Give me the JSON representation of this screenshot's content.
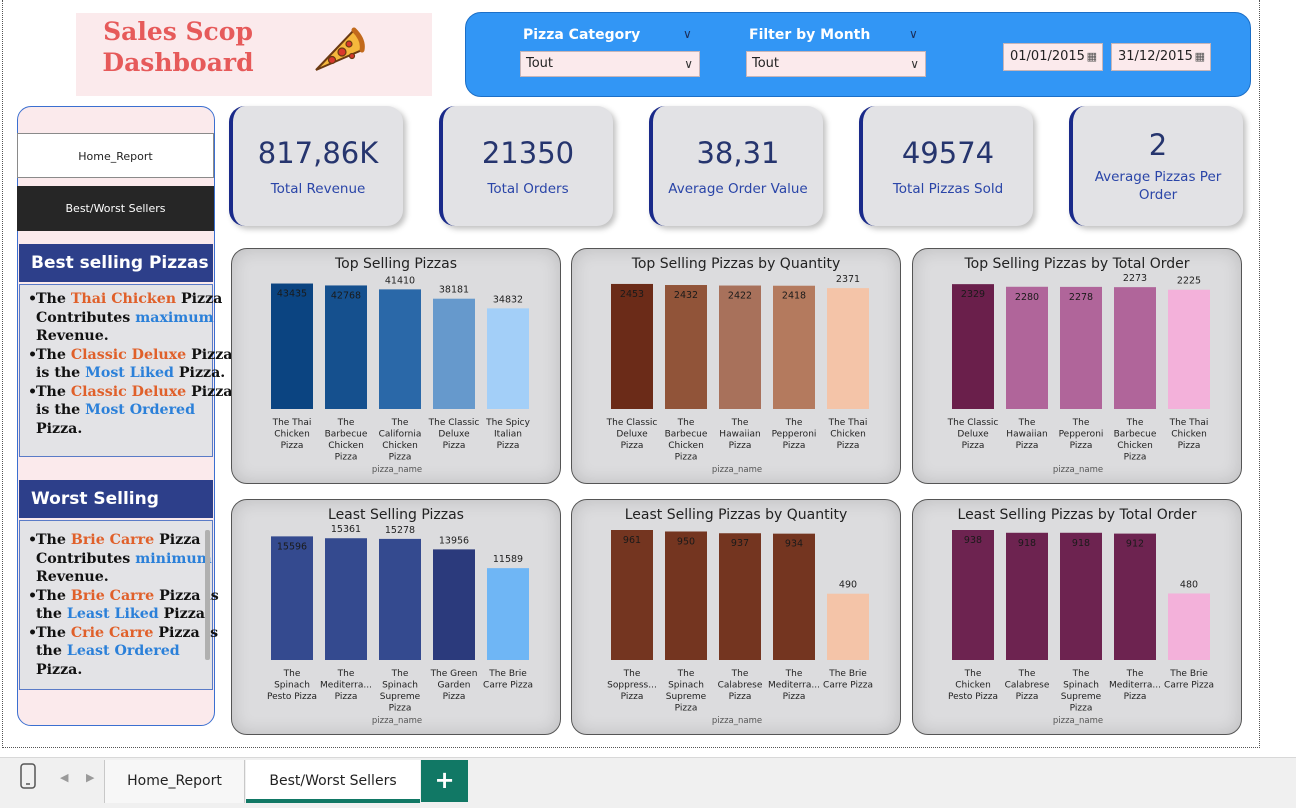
{
  "header": {
    "title_line1": "Sales Scop",
    "title_line2": "Dashboard",
    "logo_icon": "pizza-slice-icon"
  },
  "filters": {
    "category_label": "Pizza Category",
    "category_value": "Tout",
    "month_label": "Filter by Month",
    "month_value": "Tout",
    "date_start": "01/01/2015",
    "date_end": "31/12/2015"
  },
  "nav": {
    "home_label": "Home_Report",
    "sellers_label": "Best/Worst Sellers"
  },
  "best_section": {
    "title": "Best selling Pizzas",
    "lines": [
      {
        "bullet": true,
        "parts": [
          {
            "t": "The ",
            "c": ""
          },
          {
            "t": "Thai Chicken",
            "c": "o"
          },
          {
            "t": " Pizza",
            "c": ""
          }
        ]
      },
      {
        "bullet": false,
        "parts": [
          {
            "t": "Contributes ",
            "c": ""
          },
          {
            "t": "maximum",
            "c": "b"
          }
        ]
      },
      {
        "bullet": false,
        "parts": [
          {
            "t": "Revenue.",
            "c": ""
          }
        ]
      },
      {
        "bullet": true,
        "parts": [
          {
            "t": "The ",
            "c": ""
          },
          {
            "t": "Classic Deluxe",
            "c": "o"
          },
          {
            "t": " Pizza",
            "c": ""
          }
        ]
      },
      {
        "bullet": false,
        "parts": [
          {
            "t": "is the ",
            "c": ""
          },
          {
            "t": "Most Liked",
            "c": "b"
          },
          {
            "t": " Pizza.",
            "c": ""
          }
        ]
      },
      {
        "bullet": true,
        "parts": [
          {
            "t": "The ",
            "c": ""
          },
          {
            "t": "Classic Deluxe",
            "c": "o"
          },
          {
            "t": " Pizza",
            "c": ""
          }
        ]
      },
      {
        "bullet": false,
        "parts": [
          {
            "t": "is the ",
            "c": ""
          },
          {
            "t": "Most Ordered",
            "c": "b"
          }
        ]
      },
      {
        "bullet": false,
        "parts": [
          {
            "t": "Pizza.",
            "c": ""
          }
        ]
      }
    ]
  },
  "worst_section": {
    "title": "Worst Selling Pizzas",
    "lines": [
      {
        "bullet": true,
        "parts": [
          {
            "t": "The ",
            "c": ""
          },
          {
            "t": "Brie Carre",
            "c": "o"
          },
          {
            "t": " Pizza",
            "c": ""
          }
        ]
      },
      {
        "bullet": false,
        "parts": [
          {
            "t": "Contributes ",
            "c": ""
          },
          {
            "t": "minimum",
            "c": "b"
          }
        ]
      },
      {
        "bullet": false,
        "parts": [
          {
            "t": "Revenue.",
            "c": ""
          }
        ]
      },
      {
        "bullet": true,
        "parts": [
          {
            "t": "The ",
            "c": ""
          },
          {
            "t": "Brie Carre",
            "c": "o"
          },
          {
            "t": " Pizza is",
            "c": ""
          }
        ]
      },
      {
        "bullet": false,
        "parts": [
          {
            "t": "the ",
            "c": ""
          },
          {
            "t": "Least Liked",
            "c": "b"
          },
          {
            "t": " Pizza.",
            "c": ""
          }
        ]
      },
      {
        "bullet": true,
        "parts": [
          {
            "t": "The ",
            "c": ""
          },
          {
            "t": "Crie Carre",
            "c": "o"
          },
          {
            "t": " Pizza is",
            "c": ""
          }
        ]
      },
      {
        "bullet": false,
        "parts": [
          {
            "t": "the ",
            "c": ""
          },
          {
            "t": "Least Ordered",
            "c": "b"
          }
        ]
      },
      {
        "bullet": false,
        "parts": [
          {
            "t": "Pizza.",
            "c": ""
          }
        ]
      }
    ]
  },
  "kpis": [
    {
      "value": "817,86K",
      "label": "Total Revenue"
    },
    {
      "value": "21350",
      "label": "Total Orders"
    },
    {
      "value": "38,31",
      "label": "Average Order Value"
    },
    {
      "value": "49574",
      "label": "Total Pizzas Sold"
    },
    {
      "value": "2",
      "label": "Average Pizzas Per Order"
    }
  ],
  "chart_data": [
    {
      "type": "bar",
      "title": "Top Selling Pizzas",
      "xlabel": "pizza_name",
      "ymax": 45000,
      "categories": [
        [
          "The Thai",
          "Chicken",
          "Pizza"
        ],
        [
          "The",
          "Barbecue",
          "Chicken",
          "Pizza"
        ],
        [
          "The",
          "California",
          "Chicken",
          "Pizza"
        ],
        [
          "The Classic",
          "Deluxe",
          "Pizza"
        ],
        [
          "The Spicy",
          "Italian",
          "Pizza"
        ]
      ],
      "values": [
        43435,
        42768,
        41410,
        38181,
        34832
      ],
      "labels": [
        "43435",
        "42768",
        "41410",
        "38181",
        "34832"
      ],
      "colors": [
        "#0b4481",
        "#15508e",
        "#2a68a8",
        "#6699cc",
        "#a3cff8"
      ]
    },
    {
      "type": "bar",
      "title": "Top Selling Pizzas by Quantity",
      "xlabel": "pizza_name",
      "ymax": 2550,
      "categories": [
        [
          "The Classic",
          "Deluxe",
          "Pizza"
        ],
        [
          "The",
          "Barbecue",
          "Chicken",
          "Pizza"
        ],
        [
          "The",
          "Hawaiian",
          "Pizza"
        ],
        [
          "The",
          "Pepperoni",
          "Pizza"
        ],
        [
          "The Thai",
          "Chicken",
          "Pizza"
        ]
      ],
      "values": [
        2453,
        2432,
        2422,
        2418,
        2371
      ],
      "labels": [
        "2453",
        "2432",
        "2422",
        "2418",
        "2371"
      ],
      "colors": [
        "#6b2b18",
        "#915439",
        "#a8715b",
        "#b47a5e",
        "#f4c4a8"
      ]
    },
    {
      "type": "bar",
      "title": "Top Selling Pizzas by Total Order",
      "xlabel": "pizza_name",
      "ymax": 2425,
      "categories": [
        [
          "The Classic",
          "Deluxe",
          "Pizza"
        ],
        [
          "The",
          "Hawaiian",
          "Pizza"
        ],
        [
          "The",
          "Pepperoni",
          "Pizza"
        ],
        [
          "The",
          "Barbecue",
          "Chicken",
          "Pizza"
        ],
        [
          "The Thai",
          "Chicken",
          "Pizza"
        ]
      ],
      "values": [
        2329,
        2280,
        2278,
        2273,
        2225
      ],
      "labels": [
        "2329",
        "2280",
        "2278",
        "2273",
        "2225"
      ],
      "colors": [
        "#6a1f4b",
        "#b0659a",
        "#b0659a",
        "#b0659a",
        "#f3b1da"
      ]
    },
    {
      "type": "bar",
      "title": "Least Selling Pizzas",
      "xlabel": "pizza_name",
      "ymax": 16400,
      "categories": [
        [
          "The",
          "Spinach",
          "Pesto Pizza"
        ],
        [
          "The",
          "Mediterra...",
          "Pizza"
        ],
        [
          "The",
          "Spinach",
          "Supreme",
          "Pizza"
        ],
        [
          "The Green",
          "Garden",
          "Pizza"
        ],
        [
          "The Brie",
          "Carre Pizza"
        ]
      ],
      "values": [
        15596,
        15361,
        15278,
        13956,
        11589
      ],
      "labels": [
        "15596",
        "15361",
        "15278",
        "13956",
        "11589"
      ],
      "colors": [
        "#344a8f",
        "#344a8f",
        "#344a8f",
        "#2b3a7c",
        "#6fb6f5"
      ]
    },
    {
      "type": "bar",
      "title": "Least Selling Pizzas by Quantity",
      "xlabel": "pizza_name",
      "ymax": 961,
      "categories": [
        [
          "The",
          "Soppress...",
          "Pizza"
        ],
        [
          "The",
          "Spinach",
          "Supreme",
          "Pizza"
        ],
        [
          "The",
          "Calabrese",
          "Pizza"
        ],
        [
          "The",
          "Mediterra...",
          "Pizza"
        ],
        [
          "The Brie",
          "Carre Pizza"
        ]
      ],
      "values": [
        961,
        950,
        937,
        934,
        490
      ],
      "labels": [
        "961",
        "950",
        "937",
        "934",
        "490"
      ],
      "colors": [
        "#743520",
        "#743520",
        "#743520",
        "#743520",
        "#f4c4a8"
      ]
    },
    {
      "type": "bar",
      "title": "Least Selling Pizzas by Total Order",
      "xlabel": "pizza_name",
      "ymax": 938,
      "categories": [
        [
          "The",
          "Chicken",
          "Pesto Pizza"
        ],
        [
          "The",
          "Calabrese",
          "Pizza"
        ],
        [
          "The",
          "Spinach",
          "Supreme",
          "Pizza"
        ],
        [
          "The",
          "Mediterra...",
          "Pizza"
        ],
        [
          "The Brie",
          "Carre Pizza"
        ]
      ],
      "values": [
        938,
        918,
        918,
        912,
        480
      ],
      "labels": [
        "938",
        "918",
        "918",
        "912",
        "480"
      ],
      "colors": [
        "#6d2350",
        "#6d2350",
        "#6d2350",
        "#6d2350",
        "#f3b1da"
      ]
    }
  ],
  "tabs": {
    "tab1": "Home_Report",
    "tab2": "Best/Worst Sellers",
    "add_label": "+"
  }
}
